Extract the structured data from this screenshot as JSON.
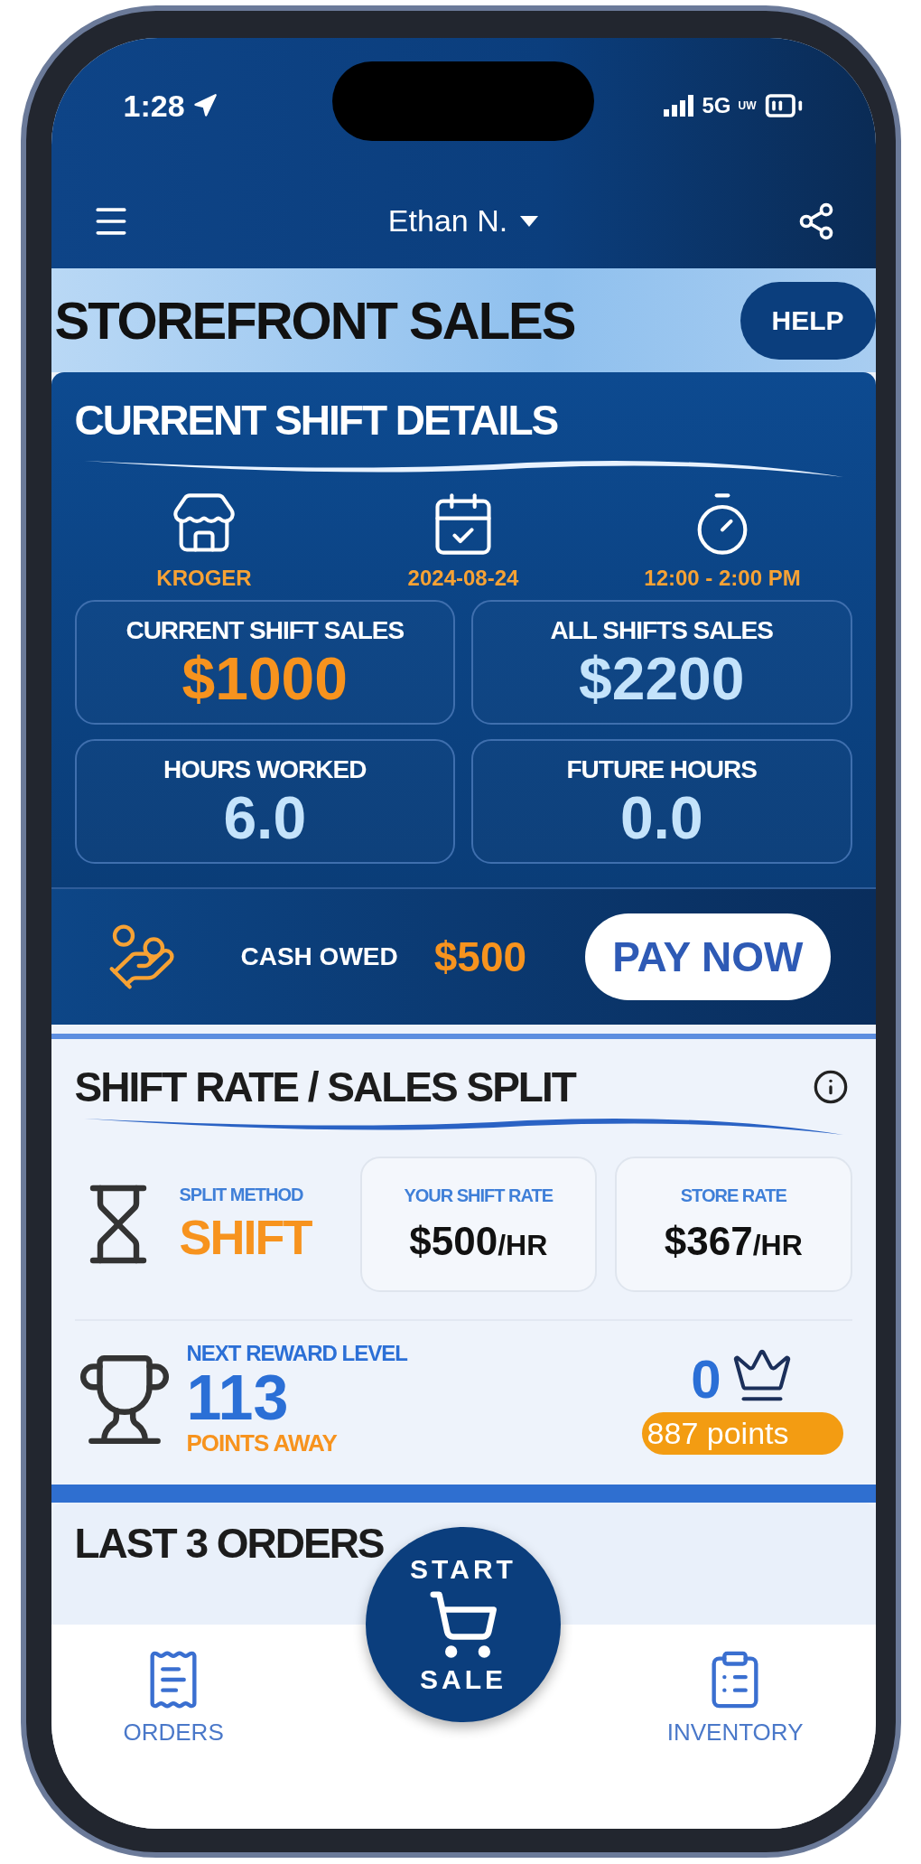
{
  "status_bar": {
    "time": "1:28",
    "network": "5G",
    "network_sub": "UW"
  },
  "header": {
    "user": "Ethan N."
  },
  "banner": {
    "title": "STOREFRONT SALES",
    "help": "HELP"
  },
  "shift_details": {
    "title": "CURRENT SHIFT DETAILS",
    "info": [
      {
        "kind": "store",
        "text": "KROGER"
      },
      {
        "kind": "date",
        "text": "2024-08-24"
      },
      {
        "kind": "time",
        "text": "12:00 - 2:00 PM"
      }
    ],
    "stats": [
      {
        "label": "CURRENT SHIFT SALES",
        "value": "$1000",
        "highlighted": true
      },
      {
        "label": "ALL SHIFTS SALES",
        "value": "$2200",
        "highlighted": false
      },
      {
        "label": "HOURS WORKED",
        "value": "6.0",
        "highlighted": false
      },
      {
        "label": "FUTURE HOURS",
        "value": "0.0",
        "highlighted": false
      }
    ]
  },
  "cash": {
    "label": "CASH OWED",
    "amount": "$500",
    "button": "PAY NOW"
  },
  "split": {
    "title": "SHIFT RATE / SALES SPLIT",
    "method_label": "SPLIT METHOD",
    "method": "SHIFT",
    "rates": [
      {
        "label": "YOUR SHIFT RATE",
        "value": "$500",
        "unit": "/HR"
      },
      {
        "label": "STORE RATE",
        "value": "$367",
        "unit": "/HR"
      }
    ]
  },
  "reward": {
    "label": "NEXT REWARD LEVEL",
    "points": "113",
    "suffix": "POINTS AWAY",
    "level": "0",
    "total": "887 points"
  },
  "orders": {
    "title": "LAST 3 ORDERS"
  },
  "start_sale": {
    "top": "START",
    "bottom": "SALE"
  },
  "nav": [
    {
      "kind": "orders",
      "label": "ORDERS"
    },
    {
      "kind": "inventory",
      "label": "INVENTORY"
    }
  ]
}
